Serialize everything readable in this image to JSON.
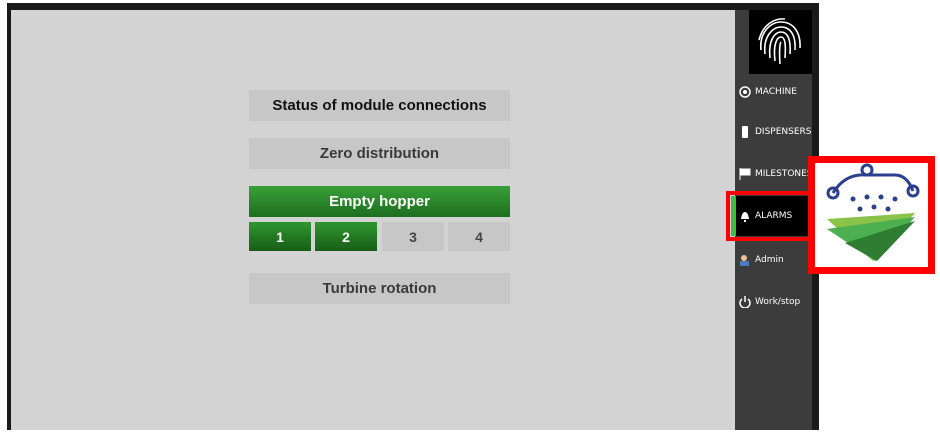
{
  "main": {
    "status_label": "Status of module connections",
    "zero_label": "Zero distribution",
    "hopper_label": "Empty hopper",
    "turbine_label": "Turbine rotation",
    "hoppers": [
      {
        "label": "1",
        "active": true
      },
      {
        "label": "2",
        "active": true
      },
      {
        "label": "3",
        "active": false
      },
      {
        "label": "4",
        "active": false
      }
    ]
  },
  "sidebar": {
    "items": [
      {
        "label": "MACHINE",
        "icon": "gear-icon"
      },
      {
        "label": "DISPENSERS",
        "icon": "dispenser-icon"
      },
      {
        "label": "MILESTONES",
        "icon": "flag-icon"
      },
      {
        "label": "ALARMS",
        "icon": "bell-icon",
        "active": true
      },
      {
        "label": "Admin",
        "icon": "user-icon"
      },
      {
        "label": "Work/stop",
        "icon": "power-icon"
      }
    ]
  },
  "colors": {
    "accent_green": "#2a8a2a",
    "highlight_red": "#ff0000",
    "brand_blue": "#2b3f8f"
  }
}
